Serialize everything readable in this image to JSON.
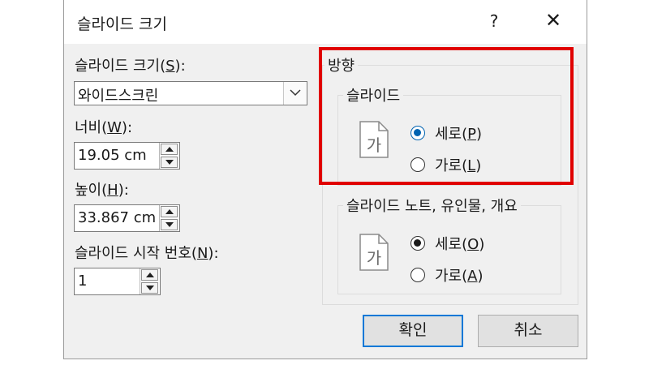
{
  "dialog": {
    "title": "슬라이드 크기",
    "help_label": "?",
    "close_label": "✕"
  },
  "size": {
    "label_pre": "슬라이드 크기(",
    "label_key": "S",
    "label_post": "):",
    "value": "와이드스크린"
  },
  "width": {
    "label_pre": "너비(",
    "label_key": "W",
    "label_post": "):",
    "value": "19.05 cm"
  },
  "height": {
    "label_pre": "높이(",
    "label_key": "H",
    "label_post": "):",
    "value": "33.867 cm"
  },
  "start_number": {
    "label_pre": "슬라이드 시작 번호(",
    "label_key": "N",
    "label_post": "):",
    "value": "1"
  },
  "orientation": {
    "title": "방향",
    "slides": {
      "title": "슬라이드",
      "icon_glyph": "가",
      "portrait": {
        "label_pre": "세로(",
        "label_key": "P",
        "label_post": ")",
        "selected": true
      },
      "landscape": {
        "label_pre": "가로(",
        "label_key": "L",
        "label_post": ")",
        "selected": false
      }
    },
    "notes": {
      "title": "슬라이드 노트, 유인물, 개요",
      "icon_glyph": "가",
      "portrait": {
        "label_pre": "세로(",
        "label_key": "O",
        "label_post": ")",
        "selected": true
      },
      "landscape": {
        "label_pre": "가로(",
        "label_key": "A",
        "label_post": ")",
        "selected": false
      }
    }
  },
  "buttons": {
    "ok": "확인",
    "cancel": "취소"
  },
  "colors": {
    "highlight": "#e00000",
    "accent": "#0078d7",
    "radio_selected": "#0063b1"
  }
}
